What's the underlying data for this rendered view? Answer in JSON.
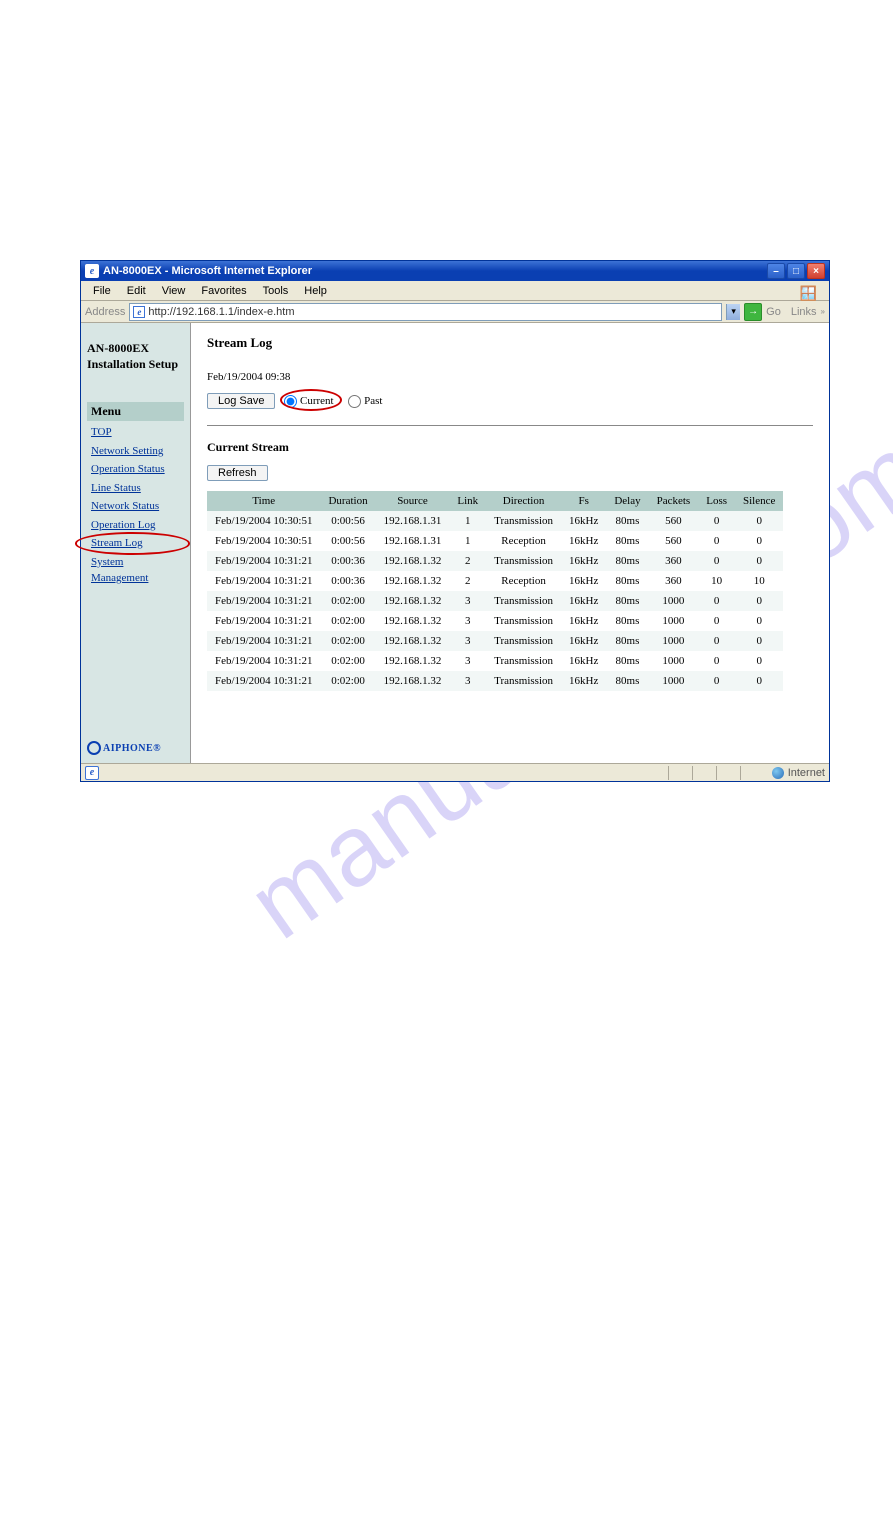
{
  "window": {
    "title": "AN-8000EX - Microsoft Internet Explorer"
  },
  "menubar": {
    "file": "File",
    "edit": "Edit",
    "view": "View",
    "favorites": "Favorites",
    "tools": "Tools",
    "help": "Help"
  },
  "addr": {
    "label": "Address",
    "url": "http://192.168.1.1/index-e.htm",
    "go": "Go",
    "links": "Links"
  },
  "sidebar": {
    "title": "AN-8000EX Installation Setup",
    "menuhdr": "Menu",
    "items": [
      {
        "label": "TOP"
      },
      {
        "label": "Network Setting"
      },
      {
        "label": "Operation Status"
      },
      {
        "label": "Line Status"
      },
      {
        "label": "Network Status"
      },
      {
        "label": "Operation Log"
      },
      {
        "label": "Stream Log"
      },
      {
        "label": "System Management"
      }
    ],
    "brand": "AIPHONE®"
  },
  "main": {
    "title": "Stream Log",
    "timestamp": "Feb/19/2004 09:38",
    "logsave": "Log Save",
    "current": "Current",
    "past": "Past",
    "subhdr": "Current Stream",
    "refresh": "Refresh",
    "cols": {
      "time": "Time",
      "duration": "Duration",
      "source": "Source",
      "link": "Link",
      "direction": "Direction",
      "fs": "Fs",
      "delay": "Delay",
      "packets": "Packets",
      "loss": "Loss",
      "silence": "Silence"
    },
    "rows": [
      {
        "time": "Feb/19/2004 10:30:51",
        "duration": "0:00:56",
        "source": "192.168.1.31",
        "link": "1",
        "direction": "Transmission",
        "fs": "16kHz",
        "delay": "80ms",
        "packets": "560",
        "loss": "0",
        "silence": "0"
      },
      {
        "time": "Feb/19/2004 10:30:51",
        "duration": "0:00:56",
        "source": "192.168.1.31",
        "link": "1",
        "direction": "Reception",
        "fs": "16kHz",
        "delay": "80ms",
        "packets": "560",
        "loss": "0",
        "silence": "0"
      },
      {
        "time": "Feb/19/2004 10:31:21",
        "duration": "0:00:36",
        "source": "192.168.1.32",
        "link": "2",
        "direction": "Transmission",
        "fs": "16kHz",
        "delay": "80ms",
        "packets": "360",
        "loss": "0",
        "silence": "0"
      },
      {
        "time": "Feb/19/2004 10:31:21",
        "duration": "0:00:36",
        "source": "192.168.1.32",
        "link": "2",
        "direction": "Reception",
        "fs": "16kHz",
        "delay": "80ms",
        "packets": "360",
        "loss": "10",
        "silence": "10"
      },
      {
        "time": "Feb/19/2004 10:31:21",
        "duration": "0:02:00",
        "source": "192.168.1.32",
        "link": "3",
        "direction": "Transmission",
        "fs": "16kHz",
        "delay": "80ms",
        "packets": "1000",
        "loss": "0",
        "silence": "0"
      },
      {
        "time": "Feb/19/2004 10:31:21",
        "duration": "0:02:00",
        "source": "192.168.1.32",
        "link": "3",
        "direction": "Transmission",
        "fs": "16kHz",
        "delay": "80ms",
        "packets": "1000",
        "loss": "0",
        "silence": "0"
      },
      {
        "time": "Feb/19/2004 10:31:21",
        "duration": "0:02:00",
        "source": "192.168.1.32",
        "link": "3",
        "direction": "Transmission",
        "fs": "16kHz",
        "delay": "80ms",
        "packets": "1000",
        "loss": "0",
        "silence": "0"
      },
      {
        "time": "Feb/19/2004 10:31:21",
        "duration": "0:02:00",
        "source": "192.168.1.32",
        "link": "3",
        "direction": "Transmission",
        "fs": "16kHz",
        "delay": "80ms",
        "packets": "1000",
        "loss": "0",
        "silence": "0"
      },
      {
        "time": "Feb/19/2004 10:31:21",
        "duration": "0:02:00",
        "source": "192.168.1.32",
        "link": "3",
        "direction": "Transmission",
        "fs": "16kHz",
        "delay": "80ms",
        "packets": "1000",
        "loss": "0",
        "silence": "0"
      }
    ]
  },
  "statusbar": {
    "zone": "Internet"
  },
  "watermark": "manualshive.com"
}
